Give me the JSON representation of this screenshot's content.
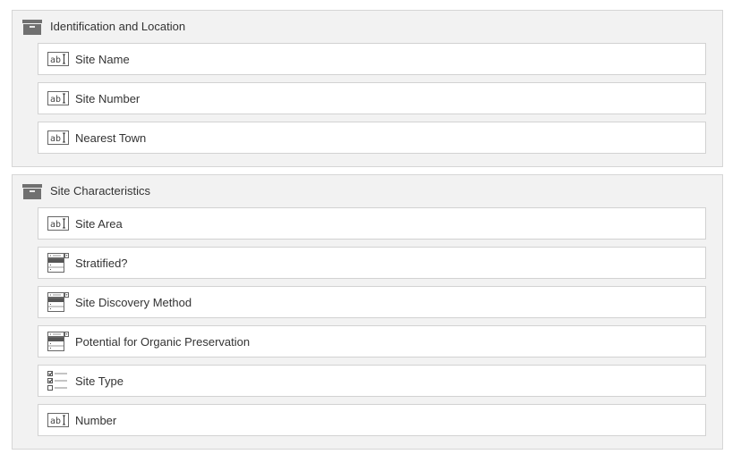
{
  "sections": [
    {
      "title": "Identification and Location",
      "icon": "archive-box-icon",
      "fields": [
        {
          "label": "Site Name",
          "icon": "text-field-icon"
        },
        {
          "label": "Site Number",
          "icon": "text-field-icon"
        },
        {
          "label": "Nearest Town",
          "icon": "text-field-icon"
        }
      ]
    },
    {
      "title": "Site Characteristics",
      "icon": "archive-box-icon",
      "fields": [
        {
          "label": "Site Area",
          "icon": "text-field-icon"
        },
        {
          "label": "Stratified?",
          "icon": "dropdown-list-icon"
        },
        {
          "label": "Site Discovery Method",
          "icon": "dropdown-list-icon"
        },
        {
          "label": "Potential for Organic Preservation",
          "icon": "dropdown-list-icon"
        },
        {
          "label": "Site Type",
          "icon": "checkbox-list-icon"
        },
        {
          "label": "Number",
          "icon": "text-field-icon"
        }
      ]
    }
  ],
  "colors": {
    "section_bg": "#f2f2f2",
    "field_bg": "#ffffff",
    "border": "#d2d2d2",
    "icon": "#6b6b6b"
  }
}
